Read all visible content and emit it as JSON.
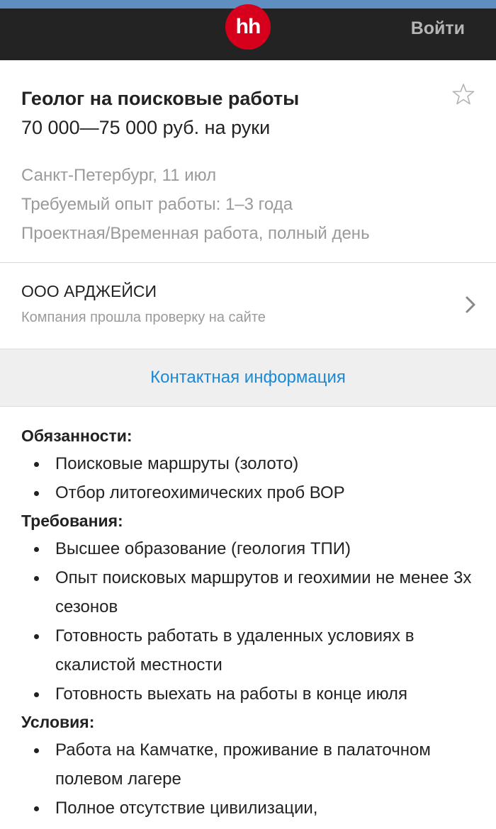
{
  "header": {
    "logo_text": "hh",
    "login_label": "Войти"
  },
  "vacancy": {
    "title": "Геолог на поисковые работы",
    "salary": "70 000—75 000 руб. на руки",
    "location_date": "Санкт-Петербург, 11 июл",
    "experience": "Требуемый опыт работы: 1–3 года",
    "employment": "Проектная/Временная работа, полный день"
  },
  "company": {
    "name": "ООО АРДЖЕЙСИ",
    "verified_text": "Компания прошла проверку на сайте"
  },
  "contact_label": "Контактная информация",
  "description": {
    "duties_title": "Обязанности:",
    "duties": [
      "Поисковые маршруты (золото)",
      "Отбор литогеохимических проб ВОР"
    ],
    "requirements_title": "Требования:",
    "requirements": [
      "Высшее образование (геология ТПИ)",
      "Опыт поисковых маршрутов и геохимии не менее 3х сезонов",
      "Готовность работать в удаленных условиях в скалистой местности",
      "Готовность выехать на работы в конце июля"
    ],
    "conditions_title": "Условия:",
    "conditions": [
      "Работа на Камчатке, проживание в палаточном полевом лагере",
      "Полное отсутствие цивилизации,"
    ]
  },
  "colors": {
    "header_bg": "#232323",
    "logo_red": "#d6001c",
    "link_blue": "#1a8ad6"
  }
}
